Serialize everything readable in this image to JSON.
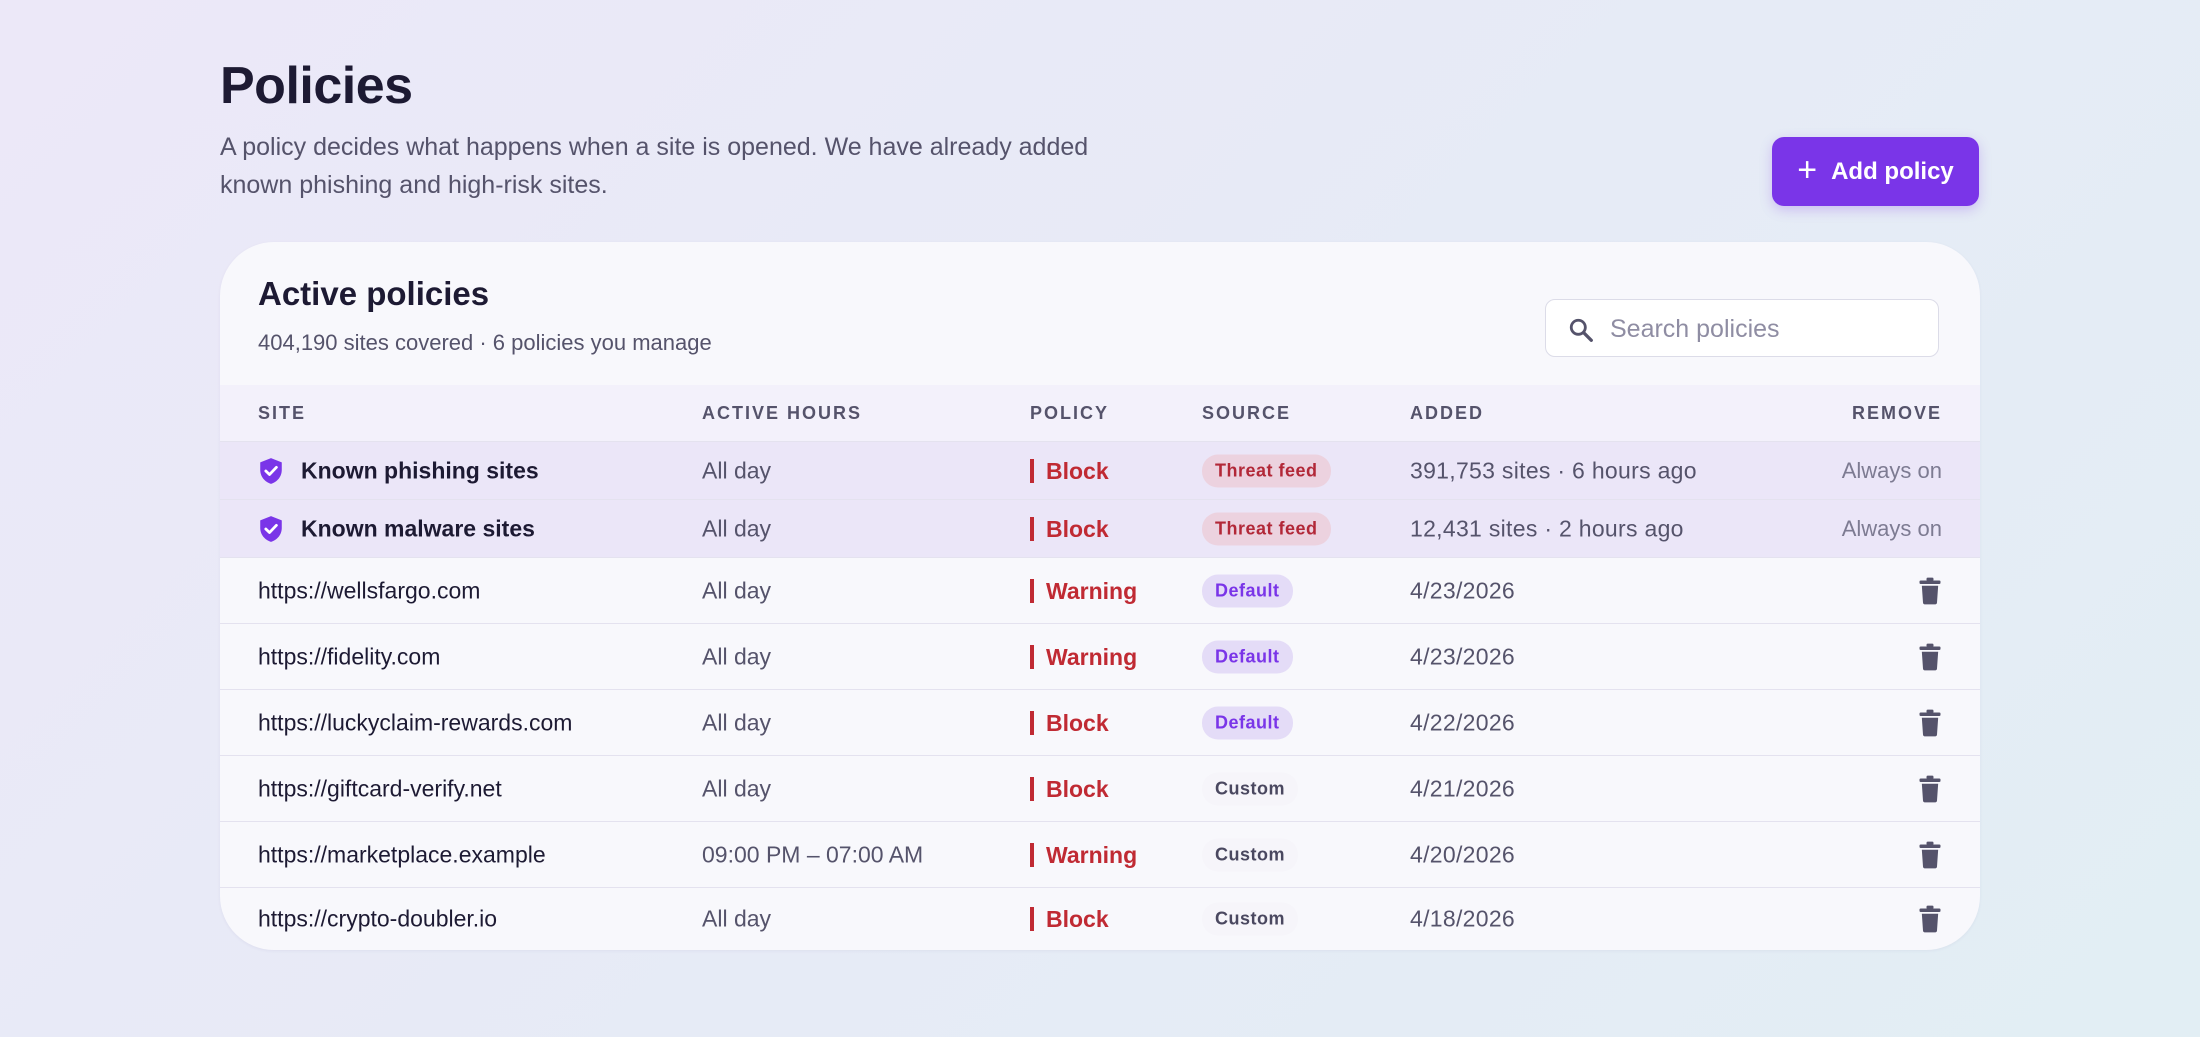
{
  "header": {
    "title": "Policies",
    "description": "A policy decides what happens when a site is opened. We have already added known phishing and high-risk sites.",
    "add_button_label": "Add policy"
  },
  "card": {
    "title": "Active policies",
    "subtitle": "404,190 sites covered · 6 policies you manage",
    "search_placeholder": "Search policies"
  },
  "columns": {
    "site": "SITE",
    "active_hours": "ACTIVE HOURS",
    "policy": "POLICY",
    "source": "SOURCE",
    "added": "ADDED",
    "remove": "REMOVE"
  },
  "system_rows": [
    {
      "site": "Known phishing sites",
      "hours": "All day",
      "policy": "Block",
      "source": "Threat feed",
      "added": "391,753 sites · 6 hours ago",
      "remove": "Always on",
      "icon": "shield-check-icon"
    },
    {
      "site": "Known malware sites",
      "hours": "All day",
      "policy": "Block",
      "source": "Threat feed",
      "added": "12,431 sites · 2 hours ago",
      "remove": "Always on",
      "icon": "shield-check-icon"
    }
  ],
  "rows": [
    {
      "site": "https://wellsfargo.com",
      "hours": "All day",
      "policy": "Warning",
      "source": "Default",
      "added": "4/23/2026"
    },
    {
      "site": "https://fidelity.com",
      "hours": "All day",
      "policy": "Warning",
      "source": "Default",
      "added": "4/23/2026"
    },
    {
      "site": "https://luckyclaim-rewards.com",
      "hours": "All day",
      "policy": "Block",
      "source": "Default",
      "added": "4/22/2026"
    },
    {
      "site": "https://giftcard-verify.net",
      "hours": "All day",
      "policy": "Block",
      "source": "Custom",
      "added": "4/21/2026"
    },
    {
      "site": "https://marketplace.example",
      "hours": "09:00 PM – 07:00 AM",
      "policy": "Warning",
      "source": "Custom",
      "added": "4/20/2026"
    },
    {
      "site": "https://crypto-doubler.io",
      "hours": "All day",
      "policy": "Block",
      "source": "Custom",
      "added": "4/18/2026"
    }
  ],
  "colors": {
    "accent": "#7a35e8",
    "danger": "#c02a33",
    "system_row_bg": "#ebe6f8"
  }
}
